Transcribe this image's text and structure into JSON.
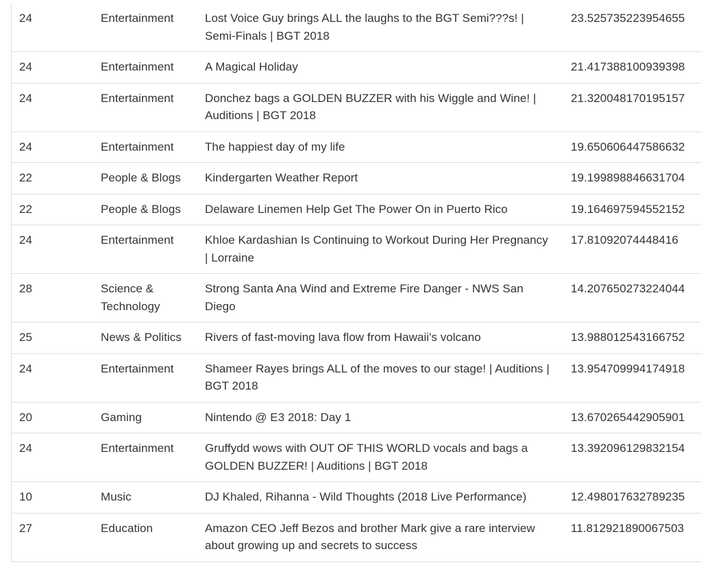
{
  "table": {
    "rows": [
      {
        "category_id": "24",
        "category": "Entertainment",
        "title": "Lost Voice Guy brings ALL the laughs to the BGT Semi???s! | Semi-Finals | BGT 2018",
        "score": "23.525735223954655"
      },
      {
        "category_id": "24",
        "category": "Entertainment",
        "title": "A Magical Holiday",
        "score": "21.417388100939398"
      },
      {
        "category_id": "24",
        "category": "Entertainment",
        "title": "Donchez bags a GOLDEN BUZZER with his Wiggle and Wine! | Auditions | BGT 2018",
        "score": "21.320048170195157"
      },
      {
        "category_id": "24",
        "category": "Entertainment",
        "title": "The happiest day of my life",
        "score": "19.650606447586632"
      },
      {
        "category_id": "22",
        "category": "People & Blogs",
        "title": "Kindergarten Weather Report",
        "score": "19.199898846631704"
      },
      {
        "category_id": "22",
        "category": "People & Blogs",
        "title": "Delaware Linemen Help Get The Power On in Puerto Rico",
        "score": "19.164697594552152"
      },
      {
        "category_id": "24",
        "category": "Entertainment",
        "title": "Khloe Kardashian Is Continuing to Workout During Her Pregnancy | Lorraine",
        "score": "17.81092074448416"
      },
      {
        "category_id": "28",
        "category": "Science & Technology",
        "title": "Strong Santa Ana Wind and Extreme Fire Danger - NWS San Diego",
        "score": "14.207650273224044"
      },
      {
        "category_id": "25",
        "category": "News & Politics",
        "title": "Rivers of fast-moving lava flow from Hawaii's volcano",
        "score": "13.988012543166752"
      },
      {
        "category_id": "24",
        "category": "Entertainment",
        "title": "Shameer Rayes brings ALL of the moves to our stage! | Auditions | BGT 2018",
        "score": "13.954709994174918"
      },
      {
        "category_id": "20",
        "category": "Gaming",
        "title": "Nintendo @ E3 2018: Day 1",
        "score": "13.670265442905901"
      },
      {
        "category_id": "24",
        "category": "Entertainment",
        "title": "Gruffydd wows with OUT OF THIS WORLD vocals and bags a GOLDEN BUZZER! | Auditions | BGT 2018",
        "score": "13.392096129832154"
      },
      {
        "category_id": "10",
        "category": "Music",
        "title": "DJ Khaled, Rihanna - Wild Thoughts (2018 Live Performance)",
        "score": "12.498017632789235"
      },
      {
        "category_id": "27",
        "category": "Education",
        "title": "Amazon CEO Jeff Bezos and brother Mark give a rare interview about growing up and secrets to success",
        "score": "11.812921890067503"
      }
    ]
  }
}
